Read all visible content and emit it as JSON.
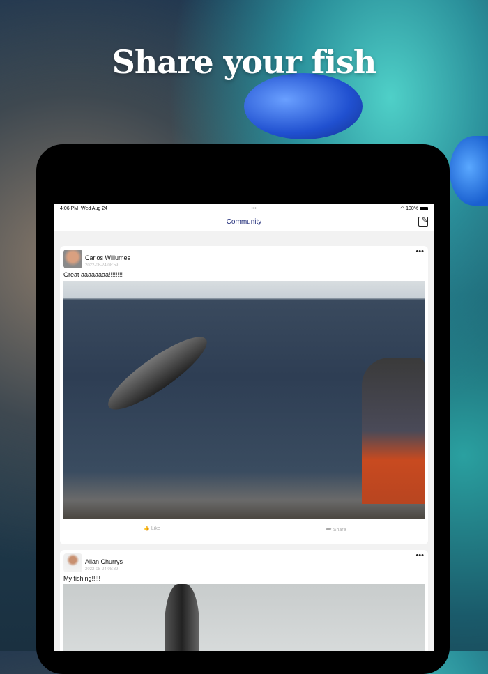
{
  "headline": "Share your fish",
  "status_bar": {
    "time": "4:06 PM",
    "date": "Wed Aug 24",
    "dots": "•••",
    "battery": "100%"
  },
  "nav": {
    "title": "Community",
    "edit_icon": "compose-icon"
  },
  "posts": [
    {
      "author": "Carlos Willumes",
      "date": "2022-08-24 08:59",
      "text": "Great aaaaaaaa!!!!!!!!",
      "like_label": "Like",
      "share_label": "Share",
      "more": "•••"
    },
    {
      "author": "Allan Churrys",
      "date": "2022-08-24 08:39",
      "text": "My fishing!!!!!",
      "more": "•••"
    }
  ]
}
